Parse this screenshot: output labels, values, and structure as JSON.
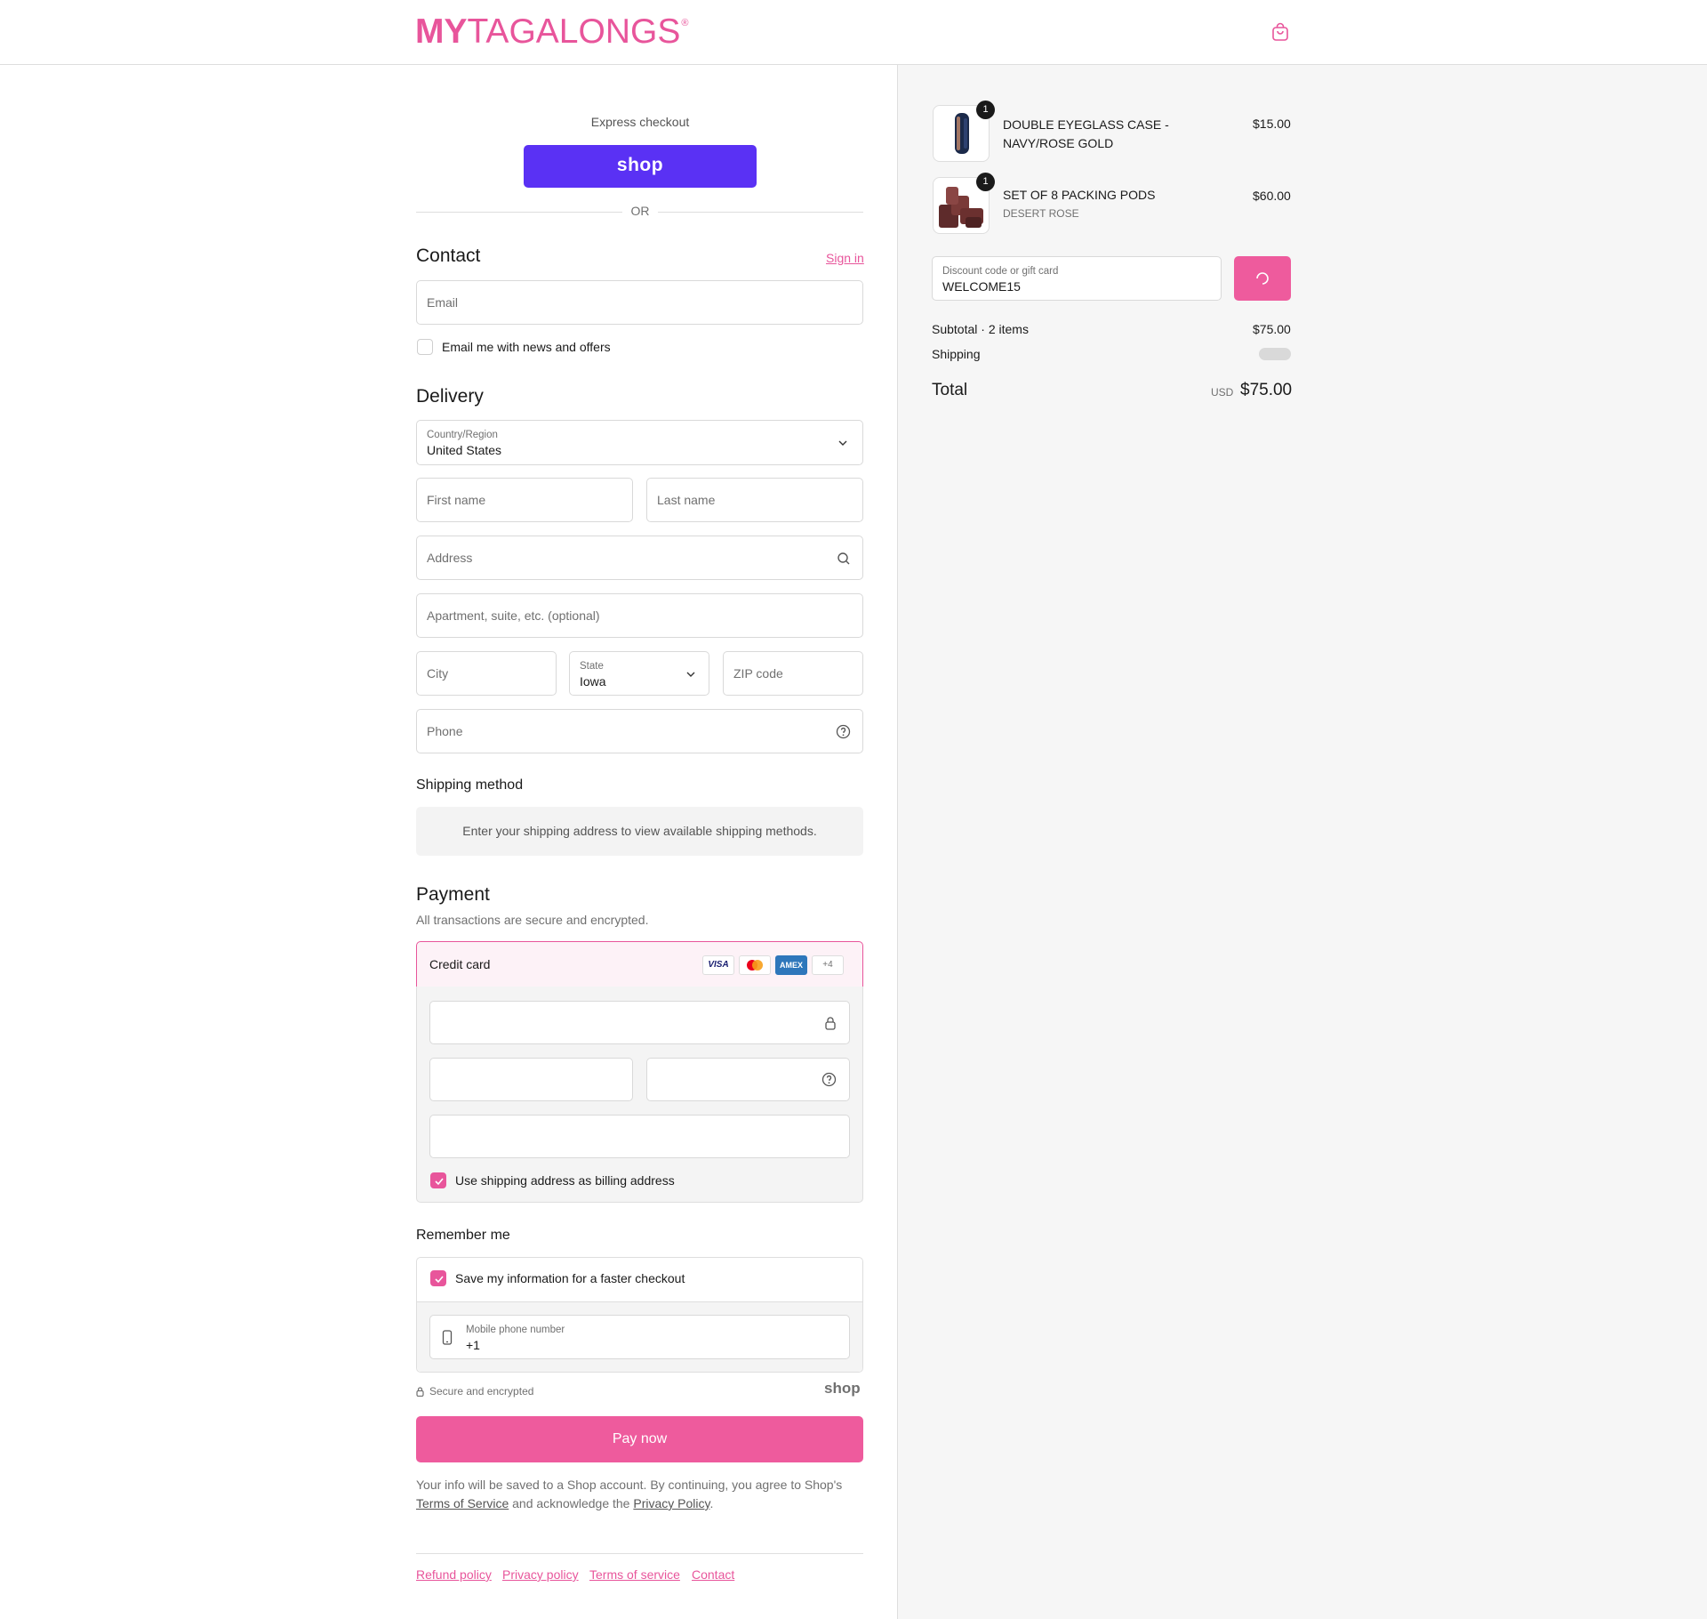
{
  "brand": {
    "logo_bold": "MY",
    "logo_light": "TAGALONGS",
    "logo_mark": "®",
    "accent": "#e8559b",
    "shop_purple": "#5a31f4"
  },
  "express": {
    "label": "Express checkout",
    "shop_button": "shop",
    "or": "OR"
  },
  "contact": {
    "title": "Contact",
    "sign_in": "Sign in",
    "email_placeholder": "Email",
    "newsletter_label": "Email me with news and offers"
  },
  "delivery": {
    "title": "Delivery",
    "country_label": "Country/Region",
    "country_value": "United States",
    "first_name": "First name",
    "last_name": "Last name",
    "address": "Address",
    "apartment": "Apartment, suite, etc. (optional)",
    "city": "City",
    "state_label": "State",
    "state_value": "Iowa",
    "zip": "ZIP code",
    "phone": "Phone"
  },
  "shipping_method": {
    "title": "Shipping method",
    "info": "Enter your shipping address to view available shipping methods."
  },
  "payment": {
    "title": "Payment",
    "subtitle": "All transactions are secure and encrypted.",
    "method": "Credit card",
    "card_logos": [
      "VISA",
      "mastercard",
      "AMEX"
    ],
    "more_cards": "+4",
    "billing_same": "Use shipping address as billing address"
  },
  "remember": {
    "title": "Remember me",
    "save_label": "Save my information for a faster checkout",
    "mobile_label": "Mobile phone number",
    "mobile_value": "+1",
    "secure": "Secure and encrypted",
    "shop_logo": "shop"
  },
  "pay_now": "Pay now",
  "legal": {
    "line1": "Your info will be saved to a Shop account. By continuing, you agree to Shop's",
    "terms": "Terms of Service",
    "middle": "and acknowledge the",
    "privacy": "Privacy Policy",
    "end": "."
  },
  "footer_links": [
    "Refund policy",
    "Privacy policy",
    "Terms of service",
    "Contact"
  ],
  "order": {
    "items": [
      {
        "name_line1": "DOUBLE EYEGLASS CASE -",
        "name_line2": "NAVY/ROSE GOLD",
        "variant": "",
        "qty": "1",
        "price": "$15.00"
      },
      {
        "name_line1": "SET OF 8 PACKING PODS",
        "name_line2": "",
        "variant": "DESERT ROSE",
        "qty": "1",
        "price": "$60.00"
      }
    ],
    "discount_label": "Discount code or gift card",
    "discount_value": "WELCOME15",
    "subtotal_label": "Subtotal · 2 items",
    "subtotal_value": "$75.00",
    "shipping_label": "Shipping",
    "total_label": "Total",
    "currency": "USD",
    "total_value": "$75.00"
  }
}
